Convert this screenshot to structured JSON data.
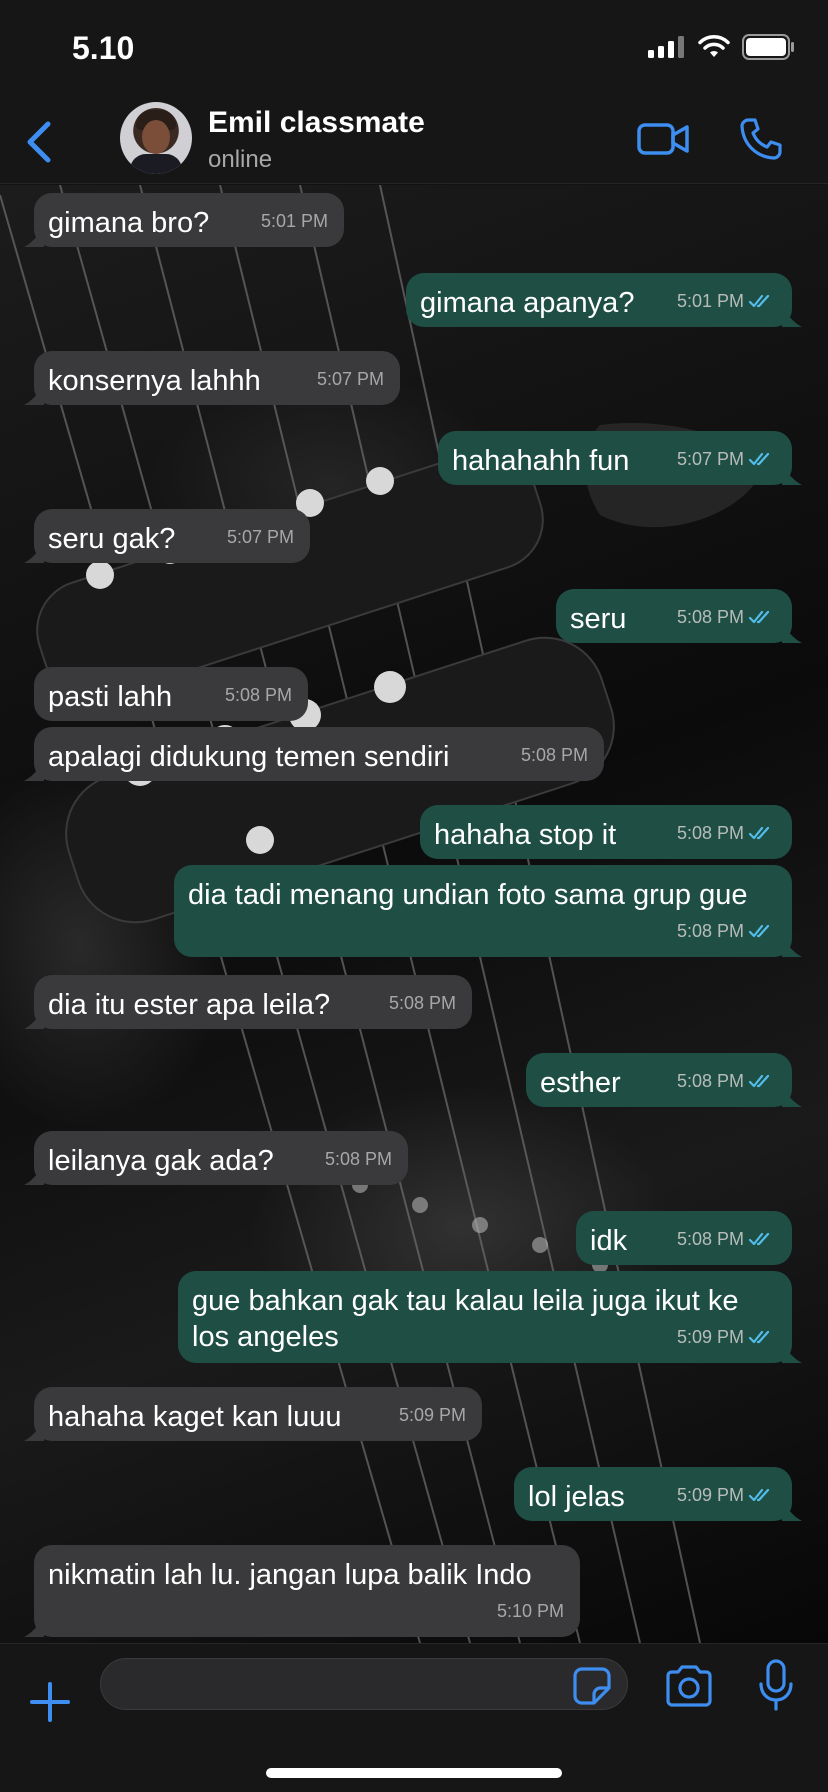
{
  "status_bar": {
    "time": "5.10"
  },
  "header": {
    "contact_name": "Emil classmate",
    "contact_status": "online"
  },
  "colors": {
    "accent": "#3d8ef0",
    "incoming_bubble": "#3a3a3c",
    "outgoing_bubble": "#1f4f44",
    "read_tick": "#53bdeb"
  },
  "messages": [
    {
      "dir": "in",
      "text": "gimana bro?",
      "time": "5:01 PM"
    },
    {
      "dir": "out",
      "text": "gimana apanya?",
      "time": "5:01 PM",
      "status": "read"
    },
    {
      "dir": "in",
      "text": "konsernya lahhh",
      "time": "5:07 PM"
    },
    {
      "dir": "out",
      "text": "hahahahh fun",
      "time": "5:07 PM",
      "status": "read"
    },
    {
      "dir": "in",
      "text": "seru gak?",
      "time": "5:07 PM"
    },
    {
      "dir": "out",
      "text": "seru",
      "time": "5:08 PM",
      "status": "read"
    },
    {
      "dir": "in",
      "text": "pasti lahh",
      "time": "5:08 PM"
    },
    {
      "dir": "in",
      "text": "apalagi didukung temen sendiri",
      "time": "5:08 PM"
    },
    {
      "dir": "out",
      "text": "hahaha stop it",
      "time": "5:08 PM",
      "status": "read"
    },
    {
      "dir": "out",
      "text": "dia tadi menang undian foto sama grup gue",
      "time": "5:08 PM",
      "status": "read"
    },
    {
      "dir": "in",
      "text": "dia itu ester apa leila?",
      "time": "5:08 PM"
    },
    {
      "dir": "out",
      "text": "esther",
      "time": "5:08 PM",
      "status": "read"
    },
    {
      "dir": "in",
      "text": "leilanya gak ada?",
      "time": "5:08 PM"
    },
    {
      "dir": "out",
      "text": "idk",
      "time": "5:08 PM",
      "status": "read"
    },
    {
      "dir": "out",
      "text": "gue bahkan gak tau kalau leila juga ikut ke los angeles",
      "time": "5:09 PM",
      "status": "read"
    },
    {
      "dir": "in",
      "text": "hahaha kaget kan luuu",
      "time": "5:09 PM"
    },
    {
      "dir": "out",
      "text": "lol jelas",
      "time": "5:09 PM",
      "status": "read"
    },
    {
      "dir": "in",
      "text": "nikmatin lah lu. jangan lupa balik Indo",
      "time": "5:10 PM"
    }
  ],
  "input": {
    "placeholder": "",
    "value": ""
  },
  "icons": {
    "back": "chevron-left-icon",
    "video": "video-camera-icon",
    "call": "phone-icon",
    "plus": "plus-icon",
    "sticker": "sticker-icon",
    "camera": "camera-icon",
    "mic": "microphone-icon"
  }
}
